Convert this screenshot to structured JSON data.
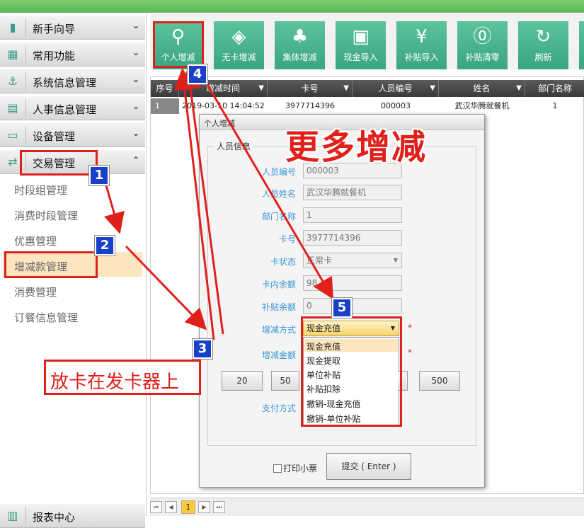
{
  "sidebar": {
    "sections": [
      {
        "label": "新手向导"
      },
      {
        "label": "常用功能"
      },
      {
        "label": "系统信息管理"
      },
      {
        "label": "人事信息管理"
      },
      {
        "label": "设备管理"
      },
      {
        "label": "交易管理"
      }
    ],
    "sub_items": [
      "时段组管理",
      "消费时段管理",
      "优惠管理",
      "增减款管理",
      "消费管理",
      "订餐信息管理"
    ],
    "report_label": "报表中心"
  },
  "toolbar": {
    "buttons": [
      "个人增减",
      "无卡增减",
      "集体增减",
      "现金导入",
      "补贴导入",
      "补贴清零",
      "刷新"
    ]
  },
  "grid": {
    "columns": [
      "序号",
      "增减时间",
      "卡号",
      "人员编号",
      "姓名",
      "部门名称"
    ],
    "row": {
      "index": "1",
      "time": "2019-03-10 14:04:52",
      "card": "3977714396",
      "person_no": "000003",
      "name": "武汉华腾就餐机",
      "dept": "1"
    }
  },
  "pager": {
    "page": "1"
  },
  "dialog": {
    "title": "个人增减",
    "legend": "人员信息",
    "fields": {
      "person_no": {
        "label": "人员编号",
        "value": "000003"
      },
      "person_name": {
        "label": "人员姓名",
        "value": "武汉华腾就餐机"
      },
      "dept_name": {
        "label": "部门名称",
        "value": "1"
      },
      "card_no": {
        "label": "卡号",
        "value": "3977714396"
      },
      "card_status": {
        "label": "卡状态",
        "value": "正常卡"
      },
      "balance": {
        "label": "卡内余额",
        "value": "98"
      },
      "subsidy": {
        "label": "补贴余额",
        "value": "0"
      },
      "method": {
        "label": "增减方式",
        "value": "现金充值"
      },
      "amount": {
        "label": "增减金额"
      },
      "pay": {
        "label": "支付方式"
      }
    },
    "required_mark": "*",
    "amount_buttons": [
      "20",
      "50",
      "500"
    ],
    "dropdown_options": [
      "现金充值",
      "现金提取",
      "单位补贴",
      "补贴扣除",
      "撤销-现金充值",
      "撤销-单位补贴"
    ],
    "print_label": "打印小票",
    "submit_label": "提交 ( Enter )"
  },
  "annotations": {
    "big_text": "更多增减",
    "placard_text": "放卡在发卡器上",
    "badges": [
      "1",
      "2",
      "3",
      "4",
      "5"
    ],
    "color": "#e0201b"
  }
}
